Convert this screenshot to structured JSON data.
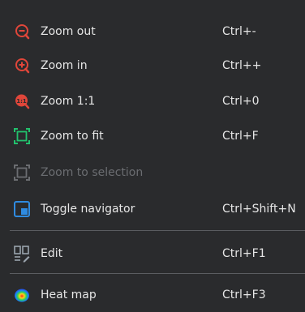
{
  "colors": {
    "background": "#2a2b2d",
    "text": "#e6e6e6",
    "disabled_text": "#6b6d71",
    "zoom_icon": "#e0463a",
    "fit_icon": "#22c26d",
    "navigator_icon": "#2f8be0",
    "edit_icon": "#9aa4ad"
  },
  "menu": {
    "items": [
      {
        "label": "Zoom out",
        "shortcut": "Ctrl+-",
        "icon": "zoom-out-icon",
        "enabled": true
      },
      {
        "label": "Zoom in",
        "shortcut": "Ctrl++",
        "icon": "zoom-in-icon",
        "enabled": true
      },
      {
        "label": "Zoom 1:1",
        "shortcut": "Ctrl+0",
        "icon": "zoom-1-1-icon",
        "enabled": true
      },
      {
        "label": "Zoom to fit",
        "shortcut": "Ctrl+F",
        "icon": "zoom-fit-icon",
        "enabled": true
      },
      {
        "label": "Zoom to selection",
        "shortcut": "",
        "icon": "zoom-selection-icon",
        "enabled": false
      },
      {
        "label": "Toggle navigator",
        "shortcut": "Ctrl+Shift+N",
        "icon": "navigator-icon",
        "enabled": true
      },
      {
        "label": "Edit",
        "shortcut": "Ctrl+F1",
        "icon": "edit-icon",
        "enabled": true
      },
      {
        "label": "Heat map",
        "shortcut": "Ctrl+F3",
        "icon": "heat-map-icon",
        "enabled": true
      }
    ]
  }
}
